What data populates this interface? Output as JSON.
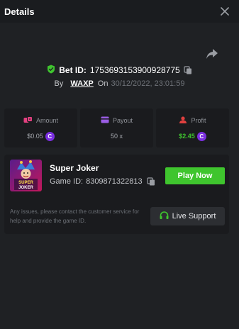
{
  "header": {
    "title": "Details",
    "close_icon": "close-icon"
  },
  "bet": {
    "id_label": "Bet ID:",
    "id_value": "1753693153900928775",
    "by_label": "By",
    "user": "WAXP",
    "on_label": "On",
    "date": "30/12/2022, 23:01:59"
  },
  "stats": {
    "amount": {
      "label": "Amount",
      "value": "$0.05",
      "icon": "dice-icon"
    },
    "payout": {
      "label": "Payout",
      "value": "50 x",
      "icon": "ticket-icon"
    },
    "profit": {
      "label": "Profit",
      "value": "$2.45",
      "icon": "user-icon"
    }
  },
  "game": {
    "name": "Super Joker",
    "id_label": "Game ID:",
    "id_value": "8309871322813",
    "thumb_text_1": "SUPER",
    "thumb_text_2": "JOKER",
    "play_label": "Play Now",
    "help_text": "Any issues, please contact the customer service for help and provide the game ID.",
    "support_label": "Live Support"
  },
  "colors": {
    "accent_green": "#3fc52e",
    "profit_green": "#3fc42f",
    "coin_purple": "#7b2fe0",
    "shield_green": "#3fc42f",
    "amount_pink": "#e2407f",
    "payout_purple": "#9b5de5",
    "profit_red": "#e0403f"
  }
}
